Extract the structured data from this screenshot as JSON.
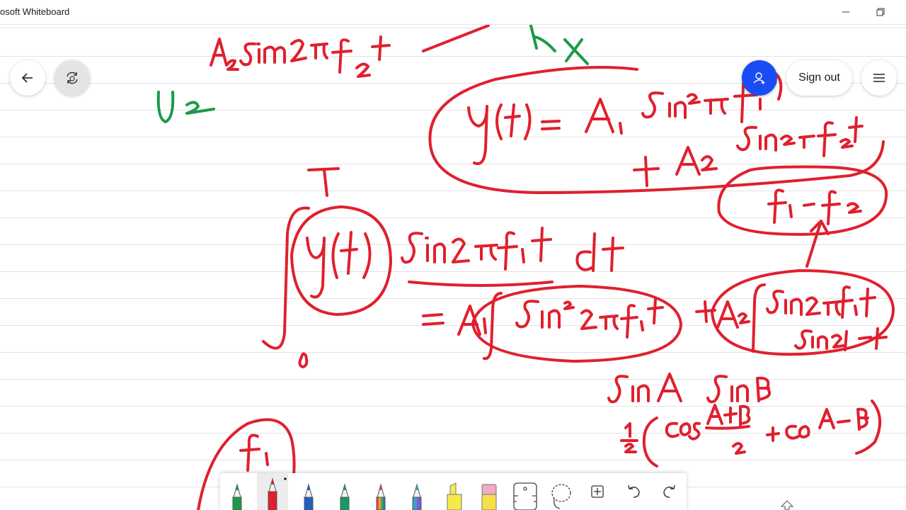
{
  "window": {
    "title": "osoft Whiteboard"
  },
  "header": {
    "sign_out_label": "Sign out",
    "accent_color": "#1a4cf5"
  },
  "icons": {
    "back": "back-arrow-icon",
    "sync": "sync-icon",
    "invite": "add-person-icon",
    "menu": "hamburger-menu-icon",
    "minimize": "minimize-icon",
    "restore": "restore-icon"
  },
  "toolbar": {
    "tools": [
      {
        "name": "pen-green",
        "color": "#1a9a4a"
      },
      {
        "name": "pen-red",
        "color": "#e0202e",
        "selected": true
      },
      {
        "name": "pen-blue",
        "color": "#1f5fbf"
      },
      {
        "name": "pen-teal",
        "color": "#179a6a"
      },
      {
        "name": "pen-rainbow",
        "color": "#e8a020"
      },
      {
        "name": "pen-galaxy",
        "color": "#7a5ad8"
      },
      {
        "name": "highlighter",
        "color": "#f6ea4a"
      },
      {
        "name": "eraser",
        "color": "#f2a9c6"
      },
      {
        "name": "ruler",
        "color": "#666666"
      },
      {
        "name": "lasso",
        "color": "#666666"
      },
      {
        "name": "add",
        "color": "#333333"
      },
      {
        "name": "undo",
        "color": "#333333"
      },
      {
        "name": "redo",
        "color": "#333333"
      }
    ]
  },
  "ink_colors": {
    "red": "#e0202e",
    "green": "#1a9a4a"
  }
}
